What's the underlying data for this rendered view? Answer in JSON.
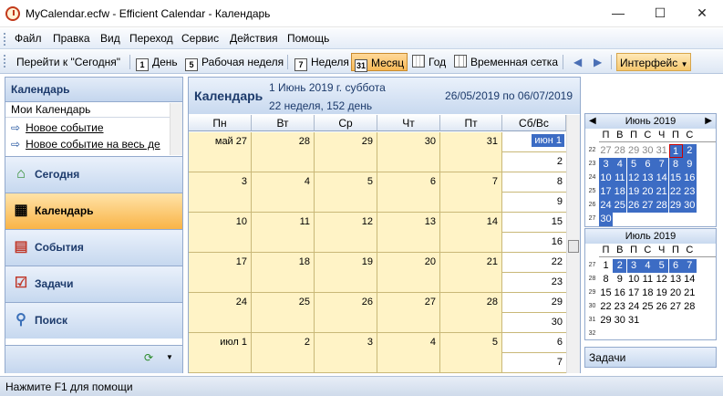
{
  "window": {
    "title": "MyCalendar.ecfw - Efficient Calendar - Календарь",
    "minimize": "—",
    "maximize": "☐",
    "close": "✕"
  },
  "menu": [
    {
      "label": "Файл",
      "key": "Ф"
    },
    {
      "label": "Правка",
      "key": "П"
    },
    {
      "label": "Вид",
      "key": "В"
    },
    {
      "label": "Переход",
      "key": "П"
    },
    {
      "label": "Сервис",
      "key": "С"
    },
    {
      "label": "Действия",
      "key": "Д"
    },
    {
      "label": "Помощь",
      "key": "П"
    }
  ],
  "toolbar": {
    "today": "Перейти к \"Сегодня\"",
    "day": "День",
    "day_icon": "1",
    "workweek": "Рабочая неделя",
    "workweek_icon": "5",
    "week": "Неделя",
    "week_icon": "7",
    "month": "Месяц",
    "month_icon": "31",
    "year": "Год",
    "timegrid": "Временная сетка",
    "interface": "Интерфейс"
  },
  "left_panel": {
    "header": "Календарь",
    "my_calendar": "Мои Календарь",
    "items": [
      "Новое событие",
      "Новое событие на весь де"
    ],
    "nav": [
      {
        "label": "Сегодня",
        "icon": "today-icon",
        "selected": false
      },
      {
        "label": "Календарь",
        "icon": "calendar-icon",
        "selected": true
      },
      {
        "label": "События",
        "icon": "events-icon",
        "selected": false
      },
      {
        "label": "Задачи",
        "icon": "tasks-icon",
        "selected": false
      },
      {
        "label": "Поиск",
        "icon": "search-icon",
        "selected": false
      }
    ]
  },
  "calendar": {
    "title": "Календарь",
    "date": "1 Июнь 2019 г. суббота",
    "week_info": "22 неделя, 152 день",
    "range": "26/05/2019 по 06/07/2019",
    "day_headers": [
      "Пн",
      "Вт",
      "Ср",
      "Чт",
      "Пт",
      "Сб/Вс"
    ],
    "weeks": [
      {
        "days": [
          "май 27",
          "28",
          "29",
          "30",
          "31"
        ],
        "sat": "июн 1",
        "sun": "2"
      },
      {
        "days": [
          "3",
          "4",
          "5",
          "6",
          "7"
        ],
        "sat": "8",
        "sun": "9"
      },
      {
        "days": [
          "10",
          "11",
          "12",
          "13",
          "14"
        ],
        "sat": "15",
        "sun": "16"
      },
      {
        "days": [
          "17",
          "18",
          "19",
          "20",
          "21"
        ],
        "sat": "22",
        "sun": "23"
      },
      {
        "days": [
          "24",
          "25",
          "26",
          "27",
          "28"
        ],
        "sat": "29",
        "sun": "30"
      },
      {
        "days": [
          "июл 1",
          "2",
          "3",
          "4",
          "5"
        ],
        "sat": "6",
        "sun": "7"
      }
    ]
  },
  "mini_calendars": [
    {
      "title": "Июнь 2019",
      "prev": "◀",
      "next": "▶",
      "dow": [
        "П",
        "В",
        "П",
        "С",
        "Ч",
        "П",
        "С"
      ],
      "rows": [
        {
          "week": "22",
          "days": [
            "27",
            "28",
            "29",
            "30",
            "31",
            "1",
            "2"
          ]
        },
        {
          "week": "23",
          "days": [
            "3",
            "4",
            "5",
            "6",
            "7",
            "8",
            "9"
          ]
        },
        {
          "week": "24",
          "days": [
            "10",
            "11",
            "12",
            "13",
            "14",
            "15",
            "16"
          ]
        },
        {
          "week": "25",
          "days": [
            "17",
            "18",
            "19",
            "20",
            "21",
            "22",
            "23"
          ]
        },
        {
          "week": "26",
          "days": [
            "24",
            "25",
            "26",
            "27",
            "28",
            "29",
            "30"
          ]
        },
        {
          "week": "27",
          "days": [
            "",
            "",
            "",
            "",
            "",
            "",
            ""
          ]
        }
      ]
    },
    {
      "title": "Июль 2019",
      "dow": [
        "П",
        "В",
        "П",
        "С",
        "Ч",
        "П",
        "С"
      ],
      "rows": [
        {
          "week": "27",
          "days": [
            "1",
            "2",
            "3",
            "4",
            "5",
            "6",
            "7"
          ]
        },
        {
          "week": "28",
          "days": [
            "8",
            "9",
            "10",
            "11",
            "12",
            "13",
            "14"
          ]
        },
        {
          "week": "29",
          "days": [
            "15",
            "16",
            "17",
            "18",
            "19",
            "20",
            "21"
          ]
        },
        {
          "week": "30",
          "days": [
            "22",
            "23",
            "24",
            "25",
            "26",
            "27",
            "28"
          ]
        },
        {
          "week": "31",
          "days": [
            "29",
            "30",
            "31",
            "",
            "",
            "",
            ""
          ]
        },
        {
          "week": "32",
          "days": [
            "",
            "",
            "",
            "",
            "",
            "",
            ""
          ]
        }
      ]
    }
  ],
  "tasks_label": "Задачи",
  "status": "Нажмите F1 для помощи"
}
